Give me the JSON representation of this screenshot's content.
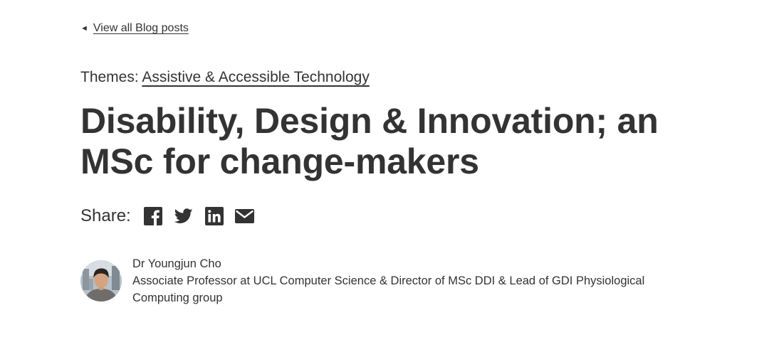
{
  "back_link": {
    "arrow": "◄",
    "label": "View all Blog posts"
  },
  "themes": {
    "prefix": "Themes: ",
    "link": "Assistive & Accessible Technology"
  },
  "title": "Disability, Design & Innovation; an MSc for change-makers",
  "share": {
    "label": "Share:",
    "icons": [
      "facebook-icon",
      "twitter-icon",
      "linkedin-icon",
      "email-icon"
    ]
  },
  "author": {
    "name": "Dr Youngjun Cho",
    "role": "Associate Professor at UCL Computer Science & Director of MSc DDI & Lead of GDI Physiological Computing group"
  },
  "colors": {
    "text": "#333333",
    "background": "#ffffff"
  }
}
